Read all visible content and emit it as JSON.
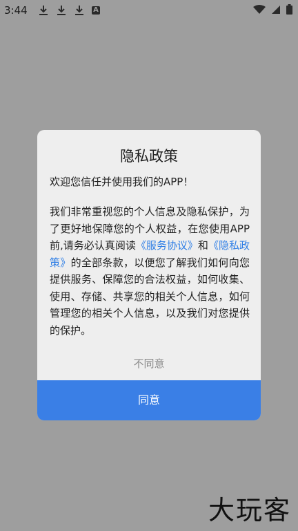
{
  "status_bar": {
    "time": "3:44",
    "left_icons": [
      "download-icon",
      "download-icon",
      "download-icon",
      "a-notification-icon"
    ],
    "right_icons": [
      "wifi-icon",
      "signal-icon",
      "battery-icon"
    ]
  },
  "dialog": {
    "title": "隐私政策",
    "welcome": "欢迎您信任并使用我们的APP！",
    "body": {
      "part1": " 我们非常重视您的个人信息及隐私保护，为了更好地保障您的个人权益，在您使用APP前,请务必认真阅读",
      "link1": "《服务协议》",
      "part2": "和",
      "link2": "《隐私政策》",
      "part3": "的全部条款，以便您了解我们如何向您提供服务、保障您的合法权益，如何收集、使用、存储、共享您的相关个人信息，如何管理您的相关个人信息，以及我们对您提供的保护。"
    },
    "disagree_label": "不同意",
    "agree_label": "同意"
  },
  "watermark": "大玩客",
  "colors": {
    "overlay": "#9e9e9e",
    "dialog_bg": "#eeeeee",
    "link": "#2e7ee6",
    "primary_button": "#3a7fe6"
  }
}
